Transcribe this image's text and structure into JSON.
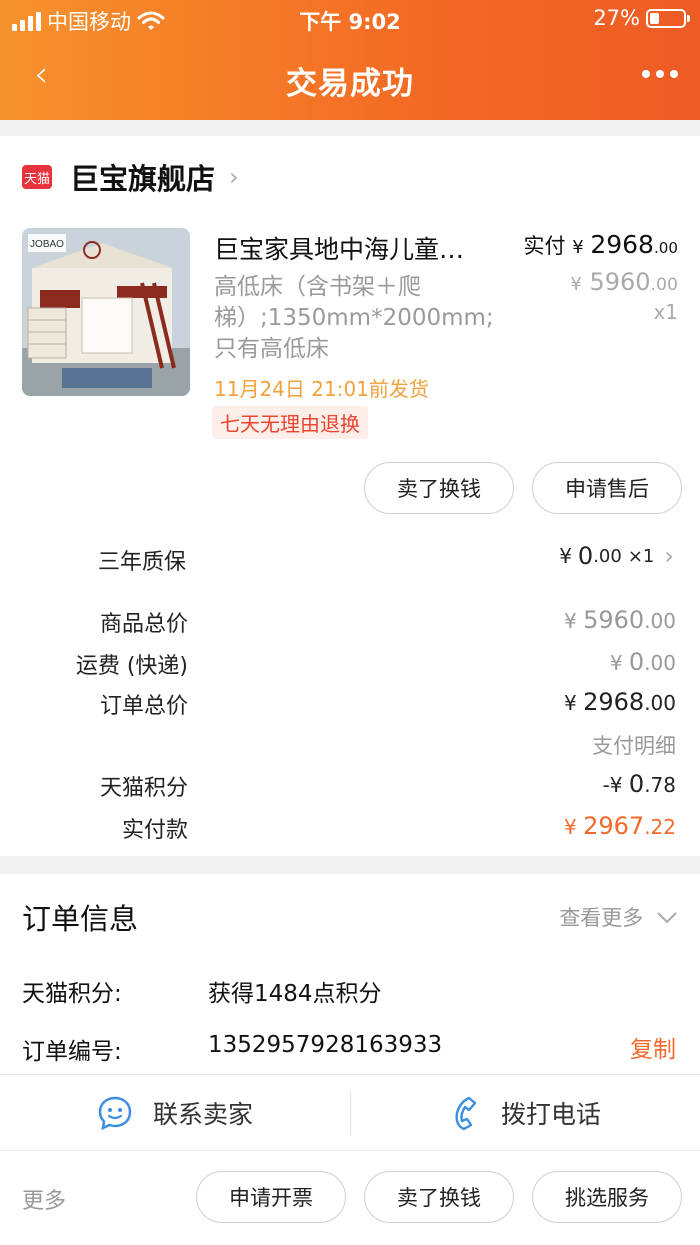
{
  "status_bar": {
    "carrier": "中国移动",
    "time": "下午 9:02",
    "battery": "27%",
    "battery_level": 0.27
  },
  "nav": {
    "back": "‹",
    "title": "交易成功"
  },
  "store": {
    "badge": "天猫",
    "name": "巨宝旗舰店",
    "chevron": "›"
  },
  "item": {
    "image_logo": "JOBAO",
    "title": "巨宝家具地中海儿童…",
    "sku": "高低床（含书架＋爬梯）;1350mm*2000mm;只有高低床",
    "ship_date": "11月24日 21:01前发货",
    "badge": "七天无理由退换",
    "paid_label": "实付",
    "currency": "¥",
    "paid_int": "2968",
    "paid_dec": ".00",
    "orig_int": "5960",
    "orig_dec": ".00",
    "qty": "x1"
  },
  "item_actions": {
    "sell_label": "卖了换钱",
    "after_sale_label": "申请售后"
  },
  "warranty": {
    "label": "三年质保",
    "currency": "¥",
    "price_int": "0",
    "price_dec": ".00",
    "qty": "×1"
  },
  "summary": {
    "goods_label": "商品总价",
    "goods_int": "5960",
    "goods_dec": ".00",
    "shipping_label": "运费 (快递)",
    "shipping_int": "0",
    "shipping_dec": ".00",
    "order_total_label": "订单总价",
    "order_total_int": "2968",
    "order_total_dec": ".00",
    "payment_detail_link": "支付明细",
    "points_label": "天猫积分",
    "points_prefix": "-¥",
    "points_int": "0",
    "points_dec": ".78",
    "paid_label": "实付款",
    "paid_int": "2967",
    "paid_dec": ".22",
    "currency": "¥"
  },
  "order_info": {
    "title": "订单信息",
    "see_more": "查看更多",
    "points_key": "天猫积分:",
    "points_value": "获得1484点积分",
    "order_no_key": "订单编号:",
    "order_no_value": "1352957928163933",
    "copy_label": "复制"
  },
  "contact": {
    "seller_label": "联系卖家",
    "call_label": "拨打电话"
  },
  "bottom_bar": {
    "more_label": "更多",
    "invoice_label": "申请开票",
    "sell_label": "卖了换钱",
    "service_label": "挑选服务"
  },
  "colors": {
    "header_start": "#f6922c",
    "header_end": "#ee5b25",
    "accent_orange": "#f2692b",
    "ship_date": "#f2a13b",
    "icon_blue": "#3b8fe0",
    "tmall_red": "#e8323c"
  }
}
